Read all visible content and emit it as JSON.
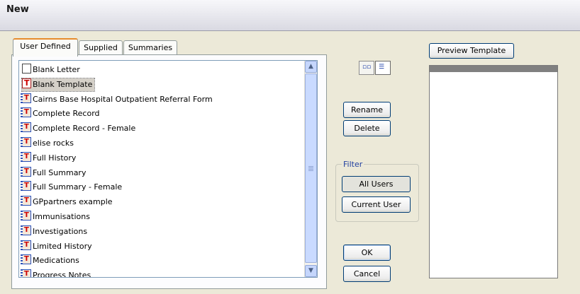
{
  "window": {
    "title": "New"
  },
  "tabs": [
    {
      "label": "User Defined",
      "active": true
    },
    {
      "label": "Supplied",
      "active": false
    },
    {
      "label": "Summaries",
      "active": false
    }
  ],
  "template_list": {
    "items": [
      {
        "label": "Blank Letter",
        "icon": "document-icon",
        "selected": false
      },
      {
        "label": "Blank Template",
        "icon": "template-icon",
        "selected": true
      },
      {
        "label": "Cairns Base Hospital Outpatient Referral Form",
        "icon": "template-stack-icon",
        "selected": false
      },
      {
        "label": "Complete Record",
        "icon": "template-stack-icon",
        "selected": false
      },
      {
        "label": "Complete Record - Female",
        "icon": "template-stack-icon",
        "selected": false
      },
      {
        "label": "elise rocks",
        "icon": "template-stack-icon",
        "selected": false
      },
      {
        "label": "Full History",
        "icon": "template-stack-icon",
        "selected": false
      },
      {
        "label": "Full Summary",
        "icon": "template-stack-icon",
        "selected": false
      },
      {
        "label": "Full Summary - Female",
        "icon": "template-stack-icon",
        "selected": false
      },
      {
        "label": "GPpartners example",
        "icon": "template-stack-icon",
        "selected": false
      },
      {
        "label": "Immunisations",
        "icon": "template-stack-icon",
        "selected": false
      },
      {
        "label": "Investigations",
        "icon": "template-stack-icon",
        "selected": false
      },
      {
        "label": "Limited History",
        "icon": "template-stack-icon",
        "selected": false
      },
      {
        "label": "Medications",
        "icon": "template-stack-icon",
        "selected": false
      },
      {
        "label": "Progress Notes",
        "icon": "template-stack-icon",
        "selected": false
      }
    ]
  },
  "view_buttons": [
    {
      "icon": "large-icons-view-icon",
      "pressed": false
    },
    {
      "icon": "list-view-icon",
      "pressed": true
    }
  ],
  "actions": {
    "rename": "Rename",
    "delete": "Delete",
    "ok": "OK",
    "cancel": "Cancel"
  },
  "filter": {
    "legend": "Filter",
    "all_users": "All Users",
    "current_user": "Current User"
  },
  "preview": {
    "button_label": "Preview Template"
  },
  "colors": {
    "accent_tab": "#e68b2c",
    "button_border": "#003c74",
    "list_border": "#7f9db9"
  }
}
